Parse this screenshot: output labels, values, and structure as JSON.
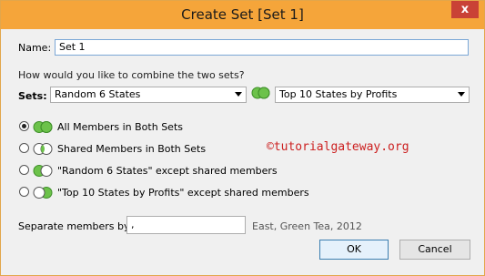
{
  "dialog": {
    "title": "Create Set [Set 1]",
    "close_glyph": "x",
    "name_label": "Name:",
    "name_value": "Set 1",
    "question": "How would you like to combine the two sets?",
    "sets_label": "Sets:",
    "set_a": "Random 6 States",
    "set_b": "Top 10 States by Profits",
    "options": [
      {
        "label": "All Members in Both Sets",
        "checked": true,
        "icon": "venn-union-icon"
      },
      {
        "label": "Shared Members in Both Sets",
        "checked": false,
        "icon": "venn-intersection-icon"
      },
      {
        "label": "\"Random 6 States\" except shared members",
        "checked": false,
        "icon": "venn-left-except-icon"
      },
      {
        "label": "\"Top 10 States by Profits\" except shared members",
        "checked": false,
        "icon": "venn-right-except-icon"
      }
    ],
    "watermark": "©tutorialgateway.org",
    "separator_label": "Separate members by:",
    "separator_value": ",",
    "separator_example": "East, Green Tea, 2012",
    "ok_label": "OK",
    "cancel_label": "Cancel"
  },
  "colors": {
    "titlebar": "#f5a53a",
    "close_button": "#c94236",
    "venn_green": "#6cc24a",
    "watermark": "#cc1f1f"
  }
}
